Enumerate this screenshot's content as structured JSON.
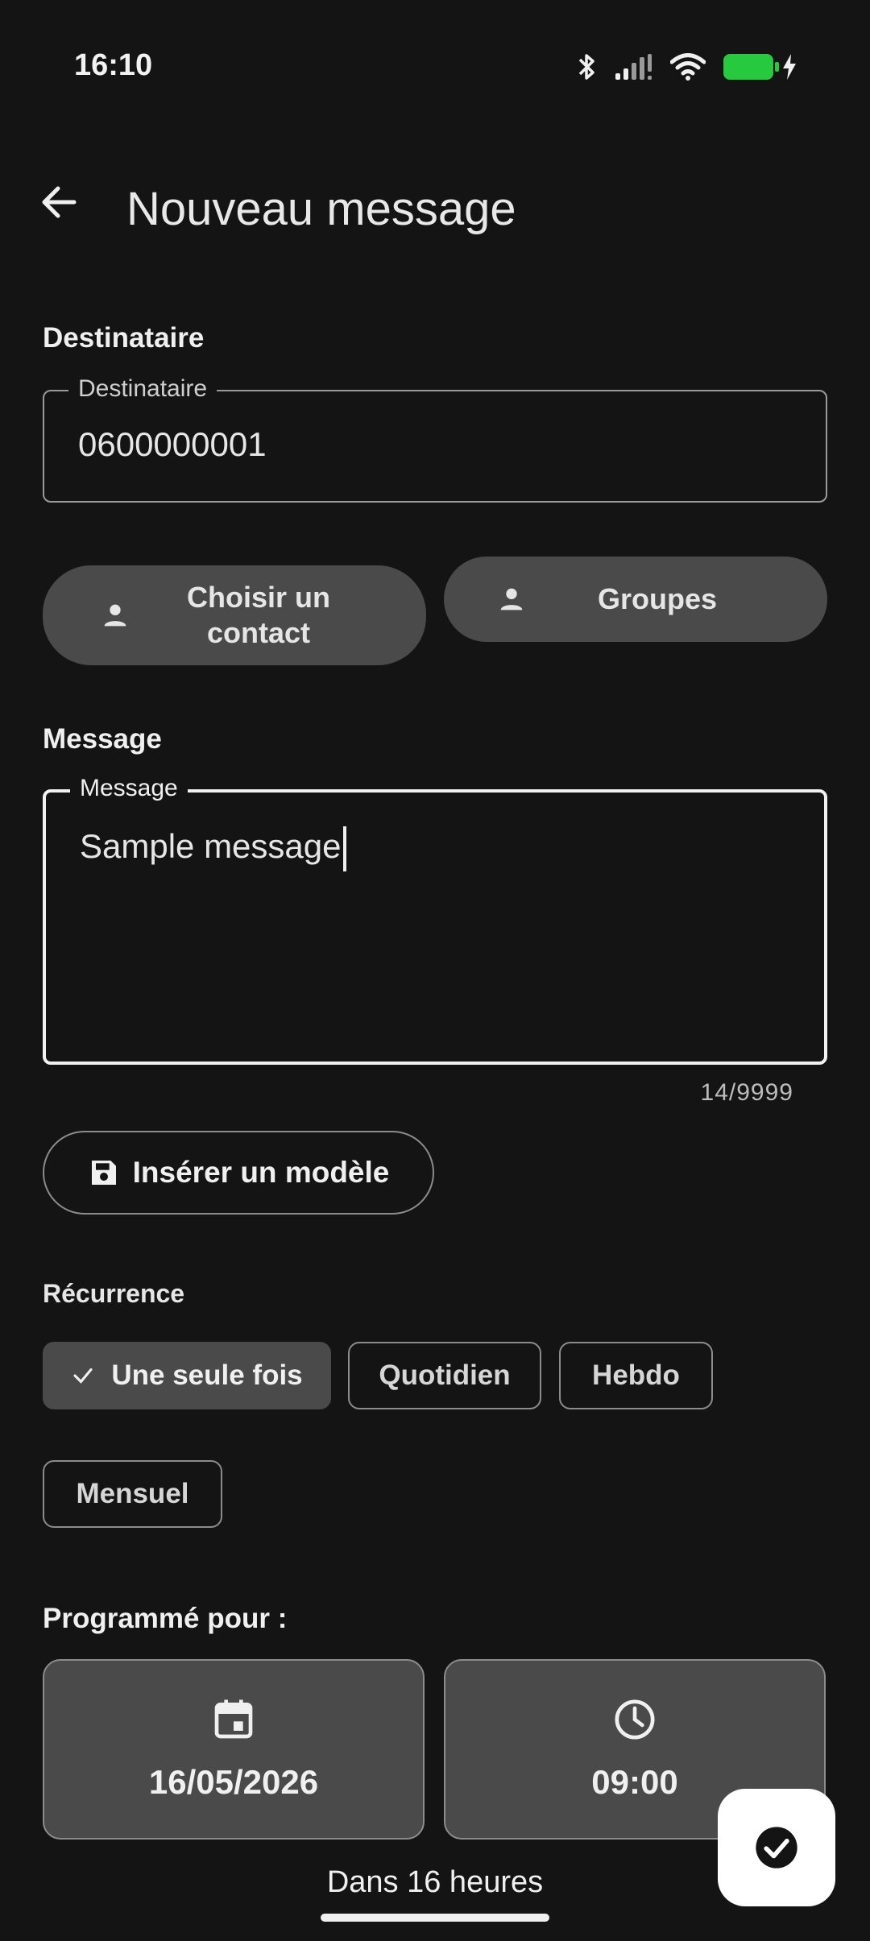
{
  "status_bar": {
    "time": "16:10"
  },
  "app_bar": {
    "title": "Nouveau message"
  },
  "recipient": {
    "section_label": "Destinataire",
    "field_label": "Destinataire",
    "value": "0600000001",
    "choose_contact_label": "Choisir un contact",
    "groups_label": "Groupes"
  },
  "message": {
    "section_label": "Message",
    "field_label": "Message",
    "value": "Sample message",
    "counter": "14/9999",
    "insert_template_label": "Insérer un modèle"
  },
  "recurrence": {
    "section_label": "Récurrence",
    "options": [
      "Une seule fois",
      "Quotidien",
      "Hebdo",
      "Mensuel"
    ],
    "selected": "Une seule fois"
  },
  "schedule": {
    "section_label": "Programmé pour :",
    "date": "16/05/2026",
    "time": "09:00",
    "relative": "Dans 16 heures"
  },
  "colors": {
    "background": "#141414",
    "surface": "#4a4a4a",
    "battery": "#27c93f",
    "fab": "#ffffff"
  }
}
